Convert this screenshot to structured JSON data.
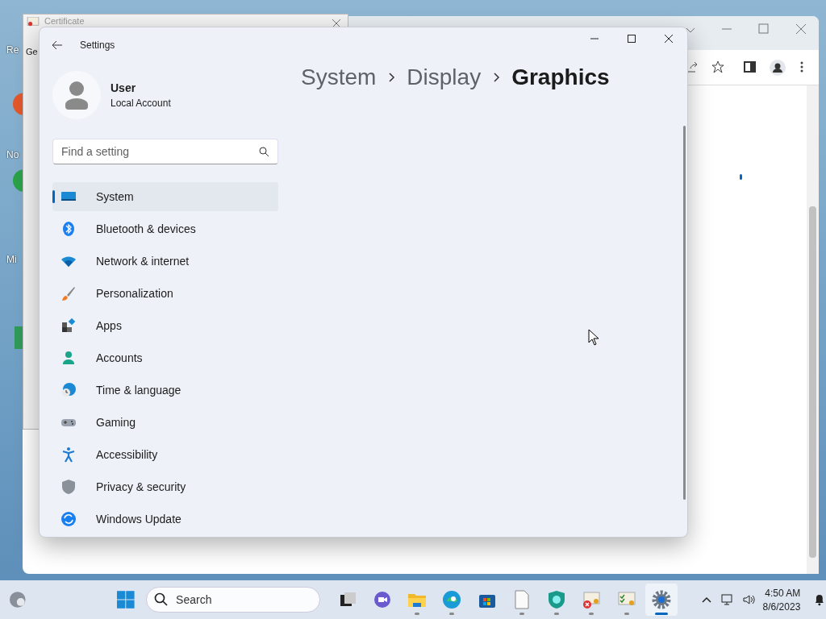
{
  "desktop_icons": [
    {
      "label": "Re"
    },
    {
      "label": "No"
    },
    {
      "label": "Mi"
    }
  ],
  "certificate_window": {
    "title": "Certificate",
    "tab": "Ge"
  },
  "settings": {
    "title": "Settings",
    "user": {
      "name": "User",
      "account": "Local Account"
    },
    "search": {
      "placeholder": "Find a setting"
    },
    "nav": [
      {
        "label": "System",
        "kind": "system",
        "selected": true
      },
      {
        "label": "Bluetooth & devices",
        "kind": "bluetooth",
        "selected": false
      },
      {
        "label": "Network & internet",
        "kind": "network",
        "selected": false
      },
      {
        "label": "Personalization",
        "kind": "brush",
        "selected": false
      },
      {
        "label": "Apps",
        "kind": "apps",
        "selected": false
      },
      {
        "label": "Accounts",
        "kind": "accounts",
        "selected": false
      },
      {
        "label": "Time & language",
        "kind": "time",
        "selected": false
      },
      {
        "label": "Gaming",
        "kind": "gaming",
        "selected": false
      },
      {
        "label": "Accessibility",
        "kind": "accessibility",
        "selected": false
      },
      {
        "label": "Privacy & security",
        "kind": "privacy",
        "selected": false
      },
      {
        "label": "Windows Update",
        "kind": "update",
        "selected": false
      }
    ],
    "breadcrumb": [
      {
        "label": "System",
        "current": false
      },
      {
        "label": "Display",
        "current": false
      },
      {
        "label": "Graphics",
        "current": true
      }
    ]
  },
  "taskbar": {
    "search": {
      "placeholder": "Search"
    },
    "apps": [
      {
        "kind": "taskview",
        "running": false,
        "selected": false
      },
      {
        "kind": "chat",
        "running": false,
        "selected": false
      },
      {
        "kind": "explorer",
        "running": true,
        "selected": false
      },
      {
        "kind": "edge",
        "running": true,
        "selected": false
      },
      {
        "kind": "store",
        "running": false,
        "selected": false
      },
      {
        "kind": "notepad",
        "running": true,
        "selected": false
      },
      {
        "kind": "defender",
        "running": true,
        "selected": false
      },
      {
        "kind": "cert-error",
        "running": true,
        "selected": false
      },
      {
        "kind": "cert-ok",
        "running": true,
        "selected": false
      },
      {
        "kind": "settings",
        "running": true,
        "selected": true
      }
    ],
    "clock": {
      "time": "4:50 AM",
      "date": "8/6/2023"
    }
  }
}
